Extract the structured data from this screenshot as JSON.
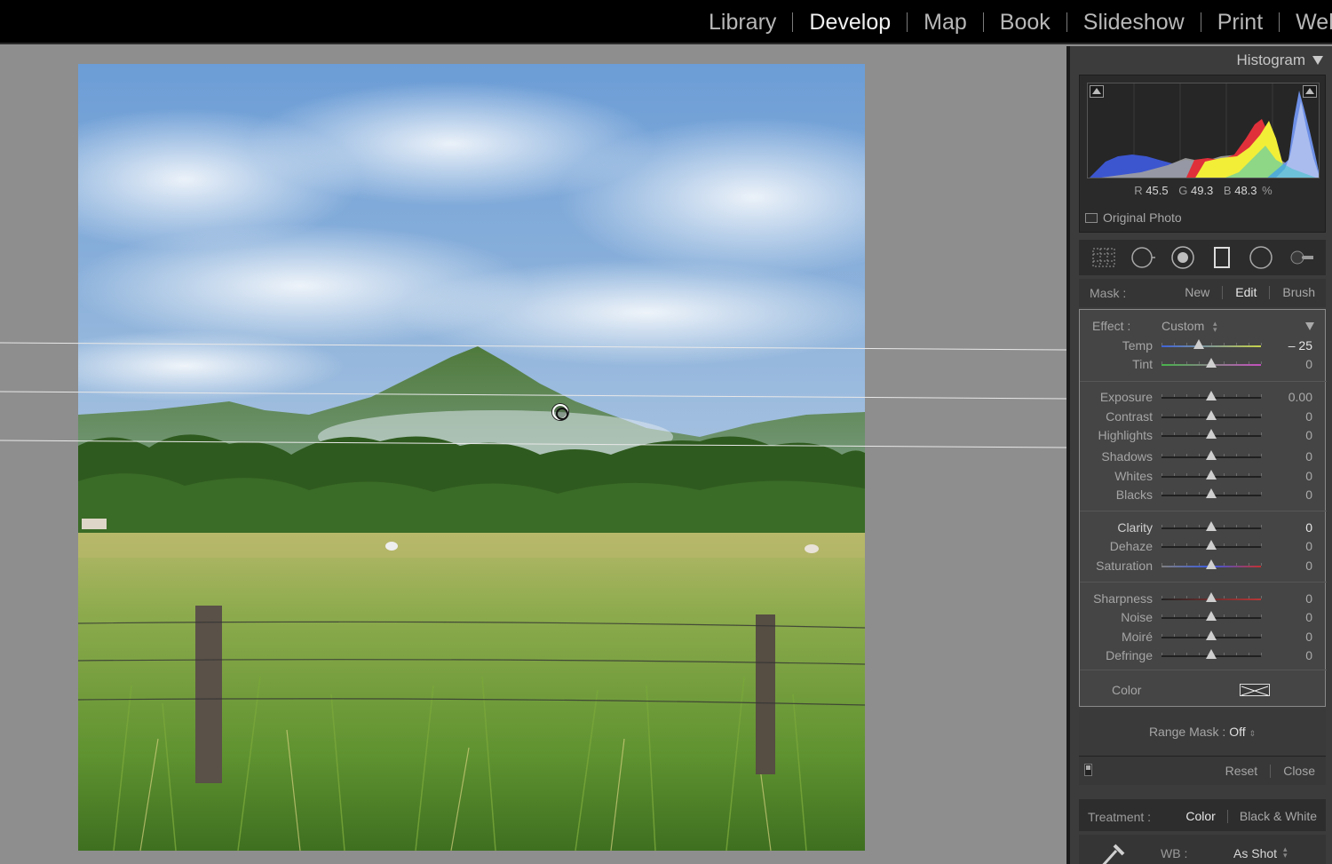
{
  "modules": [
    "Library",
    "Develop",
    "Map",
    "Book",
    "Slideshow",
    "Print",
    "Web"
  ],
  "active_module": "Develop",
  "histogram": {
    "title": "Histogram",
    "r_label": "R",
    "r_value": "45.5",
    "g_label": "G",
    "g_value": "49.3",
    "b_label": "B",
    "b_value": "48.3",
    "unit": "%",
    "original_photo_label": "Original Photo"
  },
  "tool_icons": [
    "crop-overlay-icon",
    "spot-removal-icon",
    "red-eye-icon",
    "graduated-filter-icon",
    "radial-filter-icon",
    "adjustment-brush-icon"
  ],
  "mask": {
    "label": "Mask :",
    "options": [
      "New",
      "Edit",
      "Brush"
    ],
    "active": "Edit"
  },
  "effect": {
    "label": "Effect :",
    "value": "Custom"
  },
  "sliders": [
    {
      "label": "Temp",
      "value": "– 25",
      "amount": -25
    },
    {
      "label": "Tint",
      "value": "0",
      "amount": 0
    },
    {
      "label": "Exposure",
      "value": "0.00",
      "amount": 0
    },
    {
      "label": "Contrast",
      "value": "0",
      "amount": 0
    },
    {
      "label": "Highlights",
      "value": "0",
      "amount": 0
    },
    {
      "label": "Shadows",
      "value": "0",
      "amount": 0
    },
    {
      "label": "Whites",
      "value": "0",
      "amount": 0
    },
    {
      "label": "Blacks",
      "value": "0",
      "amount": 0
    },
    {
      "label": "Clarity",
      "value": "0",
      "amount": 0
    },
    {
      "label": "Dehaze",
      "value": "0",
      "amount": 0
    },
    {
      "label": "Saturation",
      "value": "0",
      "amount": 0
    },
    {
      "label": "Sharpness",
      "value": "0",
      "amount": 0
    },
    {
      "label": "Noise",
      "value": "0",
      "amount": 0
    },
    {
      "label": "Moiré",
      "value": "0",
      "amount": 0
    },
    {
      "label": "Defringe",
      "value": "0",
      "amount": 0
    }
  ],
  "color_label": "Color",
  "range_mask": {
    "label": "Range Mask :",
    "value": "Off"
  },
  "footer": {
    "reset": "Reset",
    "close": "Close"
  },
  "treatment": {
    "label": "Treatment :",
    "options": [
      "Color",
      "Black & White"
    ],
    "active": "Color"
  },
  "wb": {
    "label": "WB :",
    "value": "As Shot"
  },
  "colors": {
    "panel_bg": "#3c3c3c",
    "top_bar": "#000000",
    "canvas_bg": "#8f8f8f",
    "hist_red": "#e0303a",
    "hist_yellow": "#f2ee38",
    "hist_blue": "#4a73e6"
  }
}
